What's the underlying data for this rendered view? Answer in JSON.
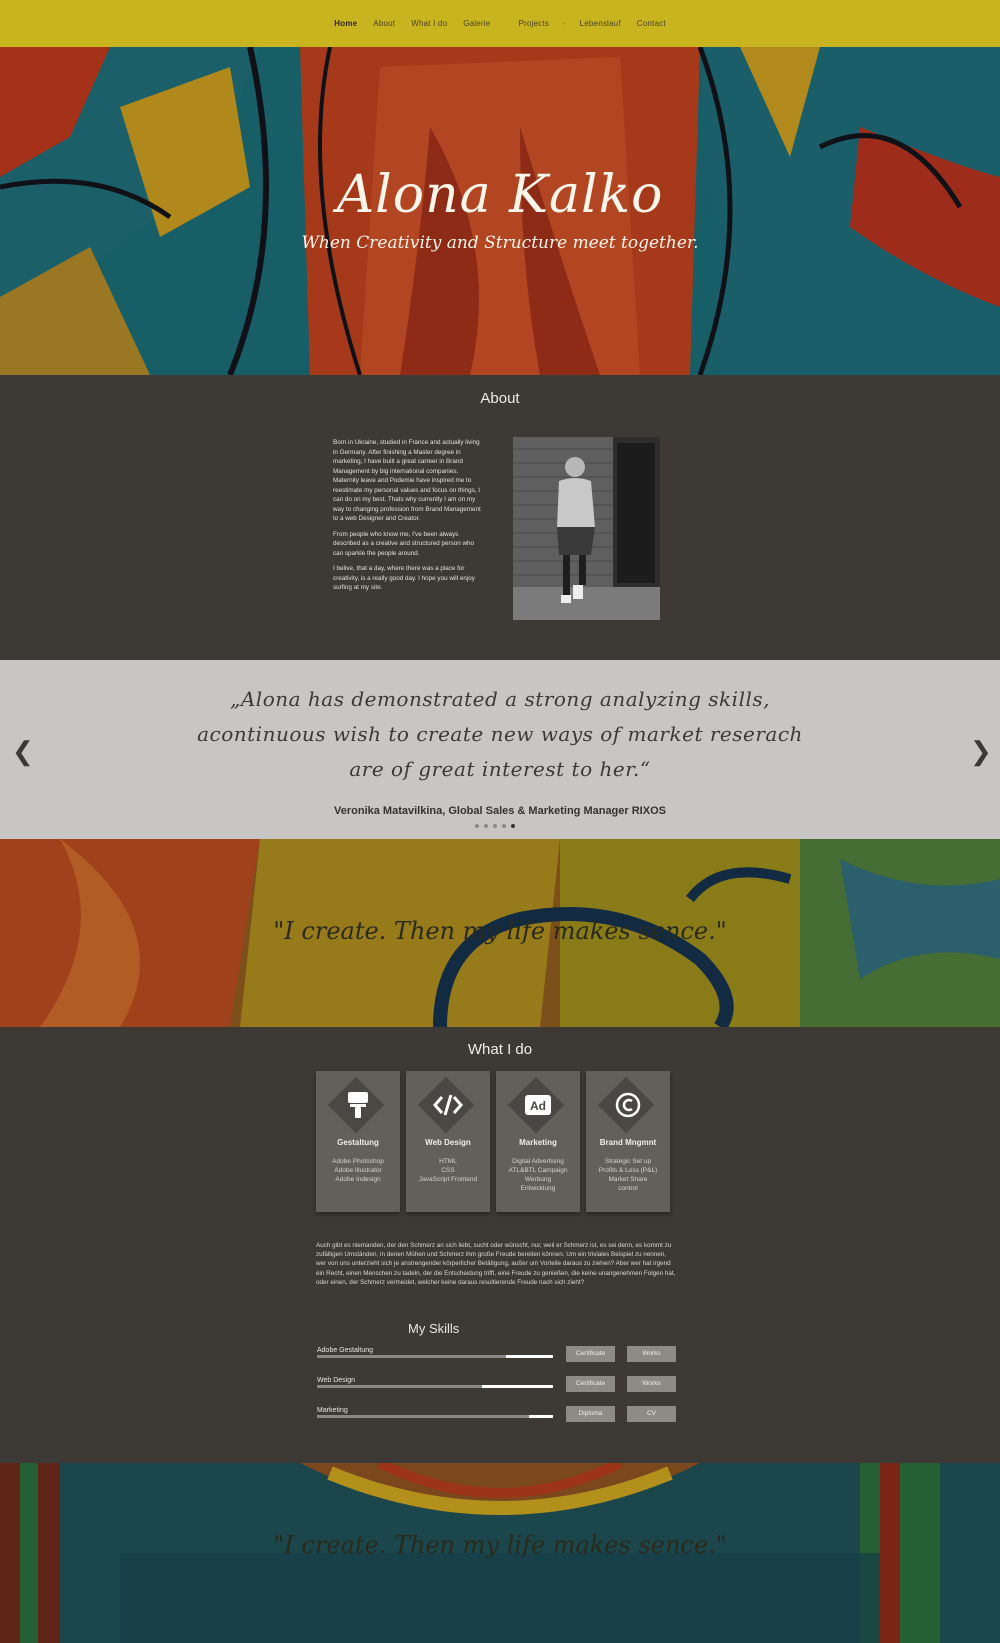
{
  "nav": {
    "items": [
      "Home",
      "About",
      "What I do",
      "Galerie",
      "Projects",
      "Lebenslauf",
      "Contact"
    ],
    "separator": "-"
  },
  "hero": {
    "title": "Alona Kalko",
    "subtitle": "When Creativity and Structure meet together."
  },
  "about": {
    "title": "About",
    "paragraphs": [
      "Born in Ukraine, studied in France and actually living in Germany. After finishing a Master degree in marketing, I have built a great carreer in Brand Management by big international companies. Maternity leave and Podemie have inspired me to reestimate my personal values and focus on things, I can do on my best. Thats why currently I am on my way to changing profession from Brand Management to a web Designer and Creator.",
      "From people who know me, I've been always described as a creative and structured person who can sparkle the people around.",
      "I belive, that a day, where there was a place for creativity, is a really good day. I hope you will enjoy surfing at my site."
    ]
  },
  "testimonial": {
    "quote": "„Alona has demonstrated a strong analyzing skills, acontinuous wish to create new ways of market reserach are of great interest to her.“",
    "author": "Veronika Matavilkina, Global Sales & Marketing Manager RIXOS",
    "slides": 5,
    "active": 4
  },
  "banner": {
    "quote": "\"I create. Then my life makes sence.\""
  },
  "whatido": {
    "title": "What I do",
    "cards": [
      {
        "title": "Gestaltung",
        "icon": "paint-roller-icon",
        "lines": [
          "Adobe Photoshop",
          "Adobe Illustrator",
          "Adobe Indesign"
        ]
      },
      {
        "title": "Web Design",
        "icon": "code-icon",
        "lines": [
          "HTML",
          "CSS",
          "JavaScript Frontend"
        ]
      },
      {
        "title": "Marketing",
        "icon": "ad-icon",
        "lines": [
          "Digital Advertising",
          "ATL&BTL Campaign",
          "Werbung",
          "Entwicklung"
        ]
      },
      {
        "title": "Brand Mngmnt",
        "icon": "copyright-icon",
        "lines": [
          "Strategic Set up",
          "Profits & Loss (P&L)",
          "Market Share",
          "control"
        ]
      }
    ],
    "lorem": "Auch gibt es niemanden, der den Schmerz an sich liebt, sucht oder wünscht, nur, weil er Schmerz ist, es sei denn, es kommt zu zufälligen Umständen, in denen Mühen und Schmerz ihm große Freude bereiten können. Um ein triviales Beispiel zu nennen, wer von uns unterzieht sich je anstrengender körperlicher Betätigung, außer um Vorteile daraus zu ziehen? Aber wer hat irgend ein Recht, einen Menschen zu tadeln, der die Entscheidung trifft, eine Freude zu genießen, die keine unangenehmen Folgen hat, oder einen, der Schmerz vermeidet, welcher keine daraus resultierende Freude nach sich zieht?"
  },
  "skills": {
    "title": "My Skills",
    "items": [
      {
        "label": "Adobe Gestaltung",
        "level": 0.8,
        "buttons": [
          "Certificate",
          "Works"
        ]
      },
      {
        "label": "Web Design",
        "level": 0.7,
        "buttons": [
          "Certificate",
          "Works"
        ]
      },
      {
        "label": "Marketing",
        "level": 0.9,
        "buttons": [
          "Diploma",
          "CV"
        ]
      }
    ]
  },
  "colors": {
    "nav_bg": "#c8b41e",
    "page_bg": "#3d3a35",
    "quote_band": "#c7c6c4",
    "card_bg": "#62605b"
  }
}
